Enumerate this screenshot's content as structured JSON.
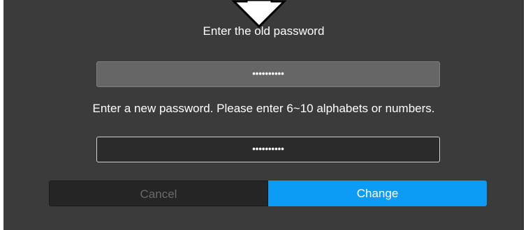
{
  "dialog": {
    "old_password_label": "Enter the old password",
    "old_password_value": "••••••••••",
    "new_password_label": "Enter a new password. Please enter 6~10 alphabets or numbers.",
    "new_password_value": "••••••••••",
    "cancel_label": "Cancel",
    "change_label": "Change"
  },
  "colors": {
    "background": "#3b3b3b",
    "accent": "#0d9cf5",
    "cancel_bg": "#252525",
    "old_field_bg": "#666666",
    "new_field_bg": "#2b2b2b"
  },
  "icons": {
    "pointer": "down-arrow-icon"
  }
}
